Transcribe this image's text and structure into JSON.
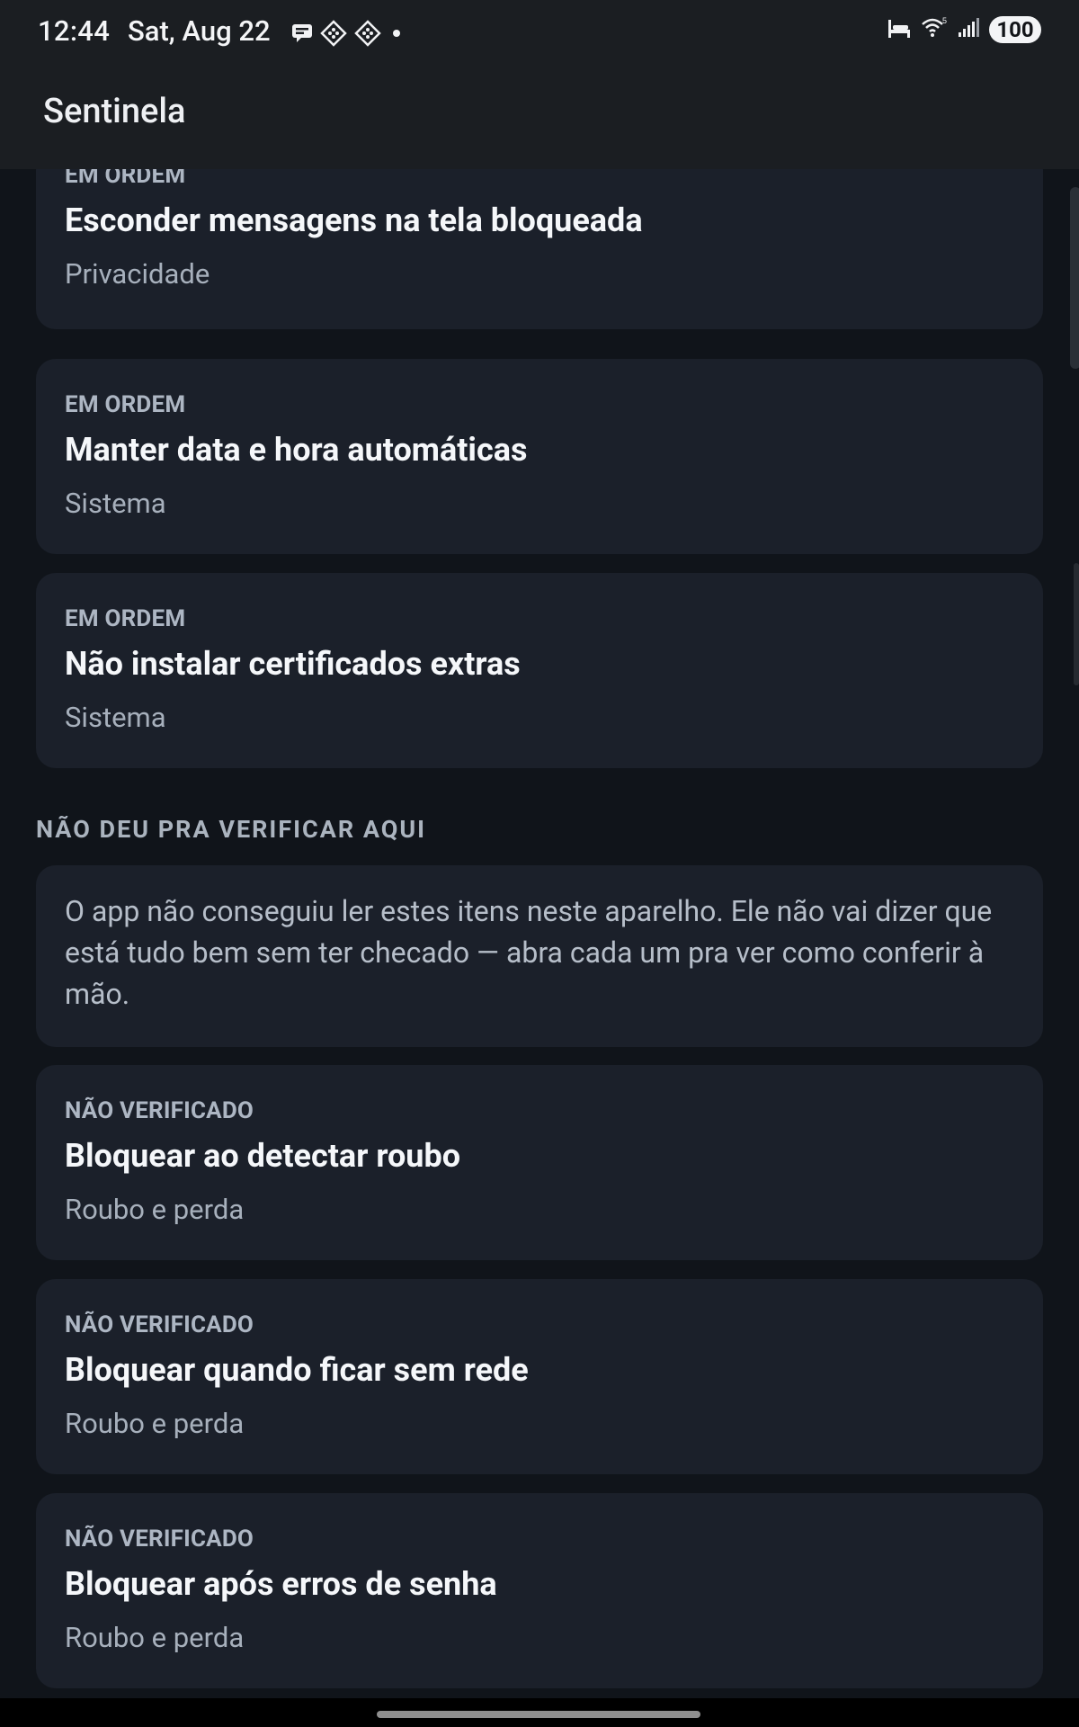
{
  "status_bar": {
    "time": "12:44",
    "date": "Sat, Aug 22",
    "battery": "100",
    "notification_icons": [
      "message-icon",
      "app-diamond-icon",
      "app-diamond-icon",
      "dot-icon"
    ],
    "system_icons": [
      "bed-icon",
      "wifi-icon",
      "signal-icon"
    ]
  },
  "app_bar": {
    "title": "Sentinela"
  },
  "cards_ok": [
    {
      "status": "EM ORDEM",
      "title": "Esconder mensagens na tela bloqueada",
      "category": "Privacidade"
    },
    {
      "status": "EM ORDEM",
      "title": "Manter data e hora automáticas",
      "category": "Sistema"
    },
    {
      "status": "EM ORDEM",
      "title": "Não instalar certificados extras",
      "category": "Sistema"
    }
  ],
  "unverified_section": {
    "header": "NÃO DEU PRA VERIFICAR AQUI",
    "info": "O app não conseguiu ler estes itens neste aparelho. Ele não vai dizer que está tudo bem sem ter checado — abra cada um pra ver como conferir à mão.",
    "cards": [
      {
        "status": "NÃO VERIFICADO",
        "title": "Bloquear ao detectar roubo",
        "category": "Roubo e perda"
      },
      {
        "status": "NÃO VERIFICADO",
        "title": "Bloquear quando ficar sem rede",
        "category": "Roubo e perda"
      },
      {
        "status": "NÃO VERIFICADO",
        "title": "Bloquear após erros de senha",
        "category": "Roubo e perda"
      }
    ]
  },
  "colors": {
    "background": "#10141a",
    "card": "#1b202a",
    "app_bar": "#1b1e22",
    "title_text": "#f5f7fa",
    "muted_text": "#a7b0bc"
  }
}
